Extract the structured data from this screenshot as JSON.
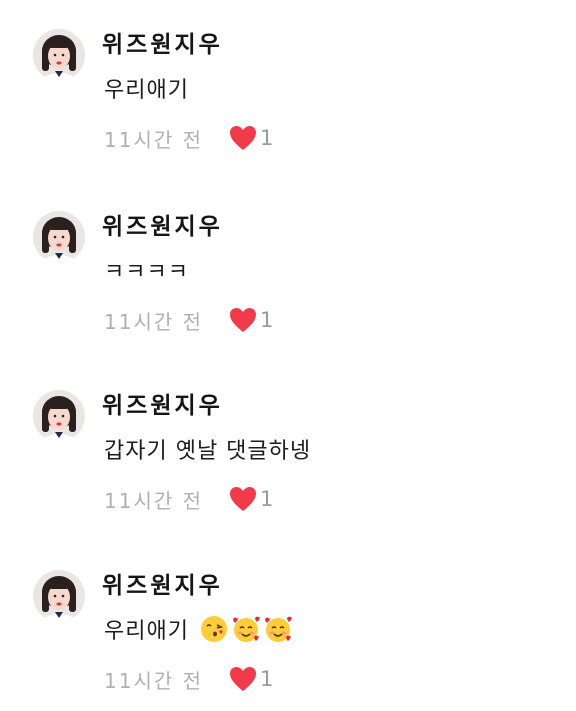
{
  "comments": [
    {
      "username": "위즈원지우",
      "text": "우리애기",
      "emojis": [],
      "timestamp": "11시간 전",
      "likes": "1"
    },
    {
      "username": "위즈원지우",
      "text": "ㅋㅋㅋㅋ",
      "emojis": [],
      "timestamp": "11시간 전",
      "likes": "1"
    },
    {
      "username": "위즈원지우",
      "text": "갑자기 옛날 댓글하넹",
      "emojis": [],
      "timestamp": "11시간 전",
      "likes": "1"
    },
    {
      "username": "위즈원지우",
      "text": "우리애기",
      "emojis": [
        "face-blowing-kiss",
        "smiling-face-with-hearts",
        "smiling-face-with-hearts"
      ],
      "timestamp": "11시간 전",
      "likes": "1"
    }
  ],
  "colors": {
    "heart": "#f23b4a",
    "timestamp": "#b0b0b0",
    "text": "#1a1a1a"
  },
  "icons": {
    "like": "heart-icon",
    "avatar": "profile-photo"
  }
}
